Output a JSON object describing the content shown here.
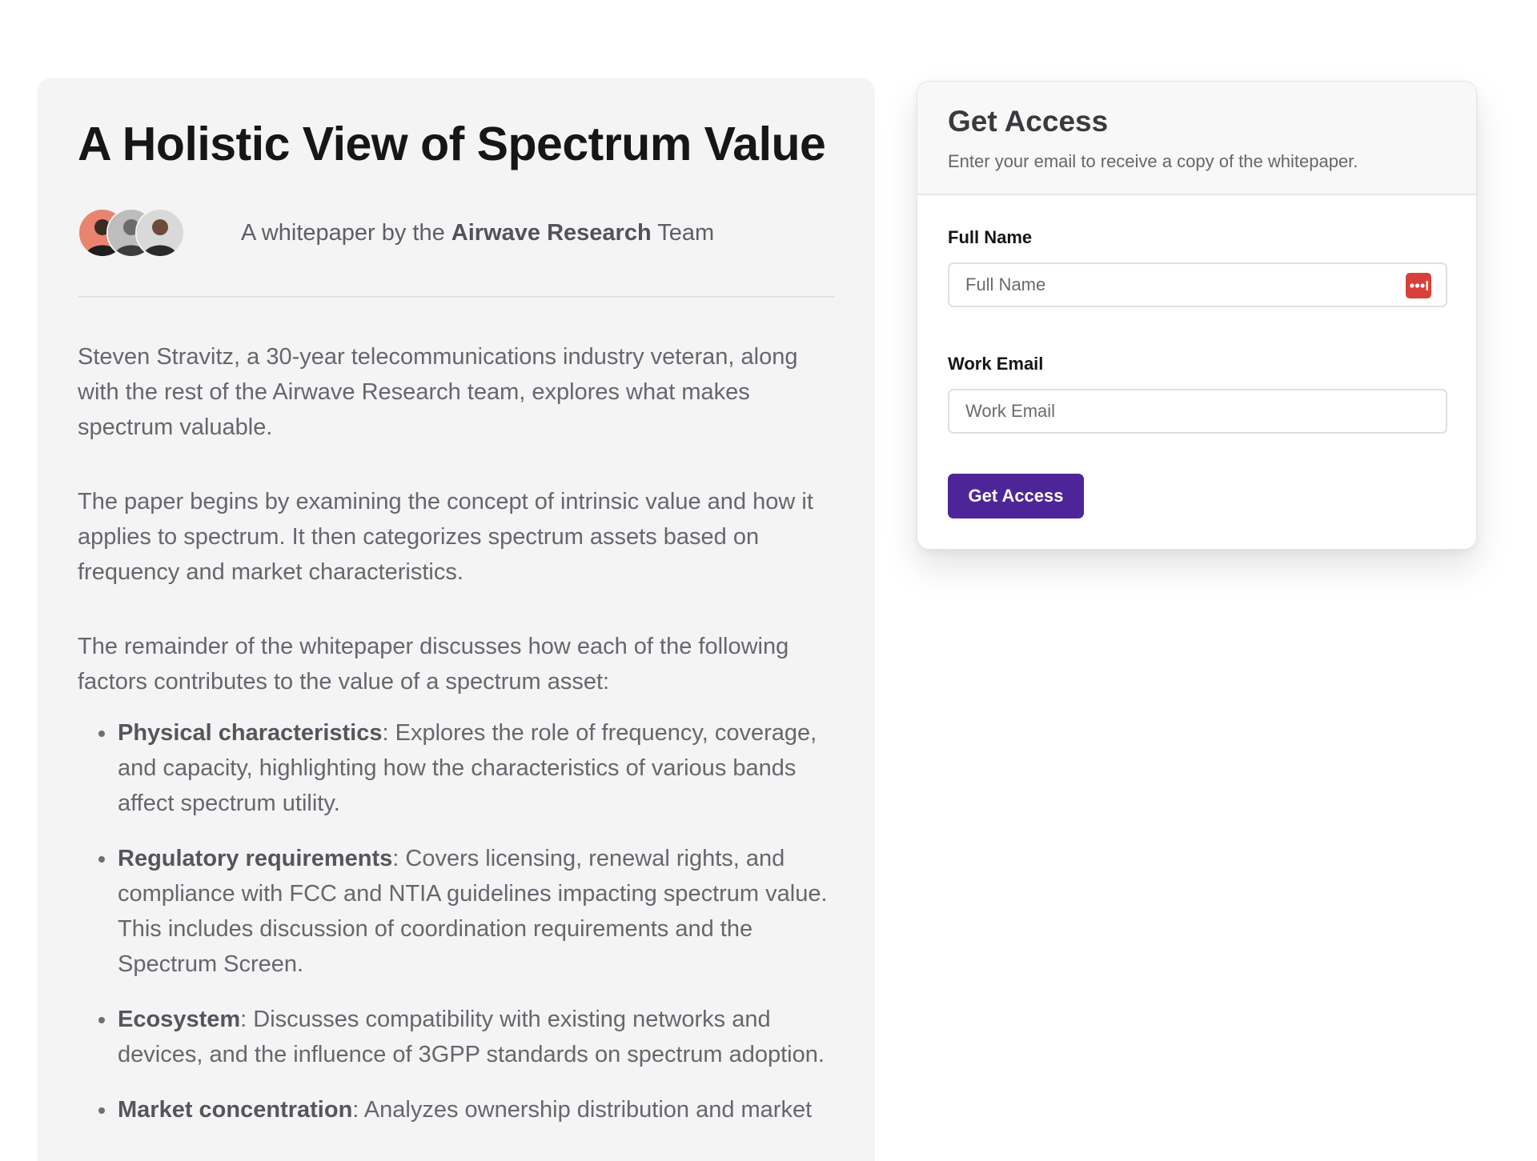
{
  "article": {
    "title": "A Holistic View of Spectrum Value",
    "byline_prefix": "A whitepaper by the",
    "byline_team": "Airwave Research",
    "byline_suffix": "Team",
    "avatars": [
      "author-avatar-1",
      "author-avatar-2",
      "author-avatar-3"
    ],
    "paragraphs": [
      "Steven Stravitz, a 30-year telecommunications industry veteran, along with the rest of the Airwave Research team, explores what makes spectrum valuable.",
      "The paper begins by examining the concept of intrinsic value and how it applies to spectrum. It then categorizes spectrum assets based on frequency and market characteristics.",
      "The remainder of the whitepaper discusses how each of the following factors contributes to the value of a spectrum asset:"
    ],
    "factors": [
      {
        "term": "Physical characteristics",
        "description": ": Explores the role of frequency, coverage, and capacity, highlighting how the characteristics of various bands affect spectrum utility."
      },
      {
        "term": "Regulatory requirements",
        "description": ": Covers licensing, renewal rights, and compliance with FCC and NTIA guidelines impacting spectrum value. This includes discussion of coordination requirements and the Spectrum Screen."
      },
      {
        "term": "Ecosystem",
        "description": ": Discusses compatibility with existing networks and devices, and the influence of 3GPP standards on spectrum adoption."
      },
      {
        "term": "Market concentration",
        "description": ": Analyzes ownership distribution and market"
      }
    ]
  },
  "form": {
    "title": "Get Access",
    "subtitle": "Enter your email to receive a copy of the whitepaper.",
    "full_name": {
      "label": "Full Name",
      "placeholder": "Full Name",
      "value": "",
      "icon": "password-manager-icon"
    },
    "work_email": {
      "label": "Work Email",
      "placeholder": "Work Email",
      "value": ""
    },
    "submit_label": "Get Access"
  },
  "colors": {
    "panel_bg": "#f4f4f4",
    "accent": "#4e2599",
    "password_manager_icon": "#d9403a"
  }
}
